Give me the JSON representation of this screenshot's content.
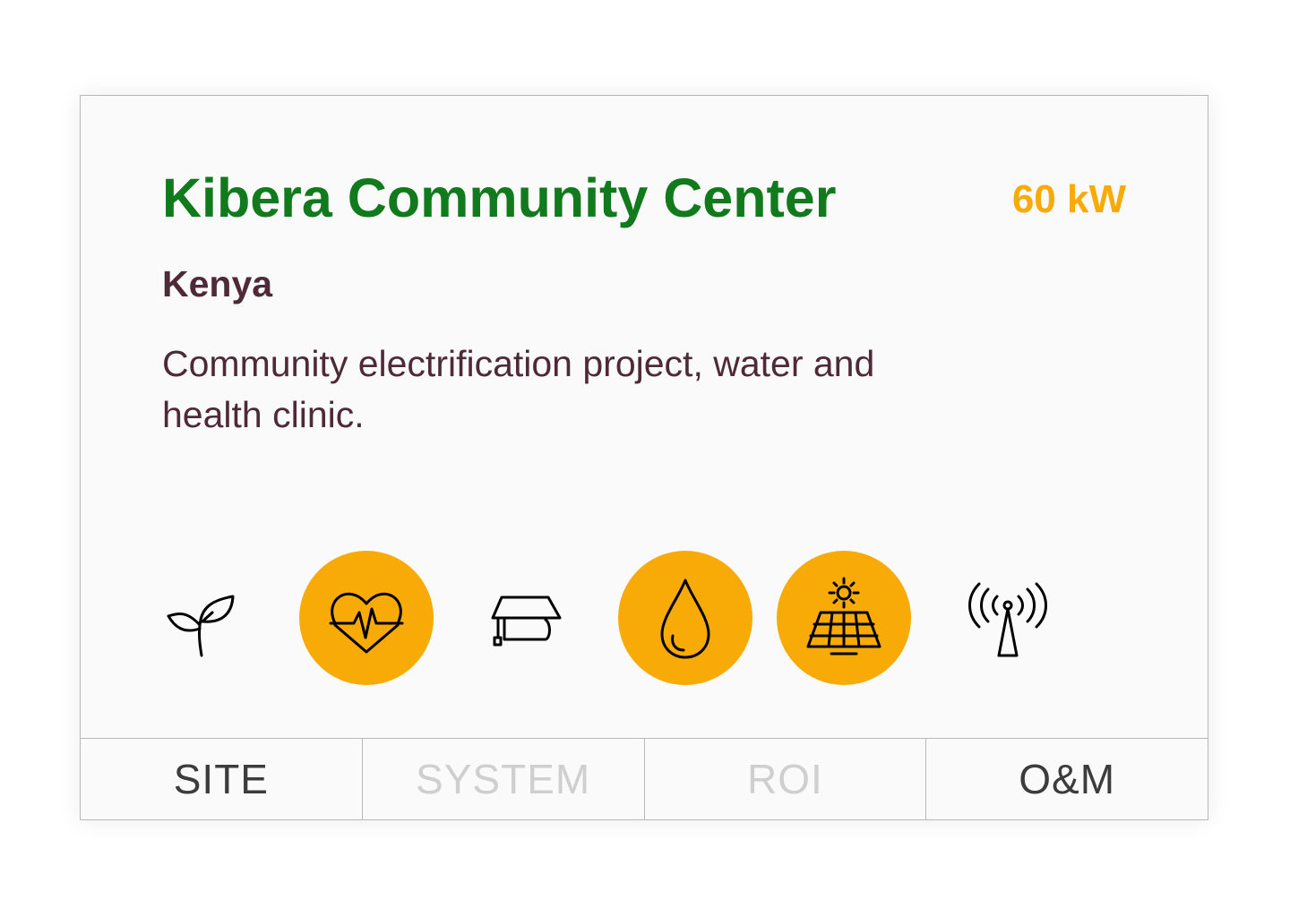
{
  "card": {
    "title": "Kibera Community Center",
    "power": "60 kW",
    "country": "Kenya",
    "description": "Community electrification project, water and health clinic."
  },
  "icons": [
    {
      "name": "plant-icon",
      "active": false
    },
    {
      "name": "health-icon",
      "active": true
    },
    {
      "name": "education-icon",
      "active": false
    },
    {
      "name": "water-icon",
      "active": true
    },
    {
      "name": "solar-panel-icon",
      "active": true
    },
    {
      "name": "telecom-tower-icon",
      "active": false
    }
  ],
  "tabs": [
    {
      "label": "SITE",
      "enabled": true
    },
    {
      "label": "SYSTEM",
      "enabled": false
    },
    {
      "label": "ROI",
      "enabled": false
    },
    {
      "label": "O&M",
      "enabled": true
    }
  ],
  "colors": {
    "title": "#107a1c",
    "accent": "#f8ab06",
    "text": "#4e2a38",
    "disabled": "#cfcfcf"
  }
}
